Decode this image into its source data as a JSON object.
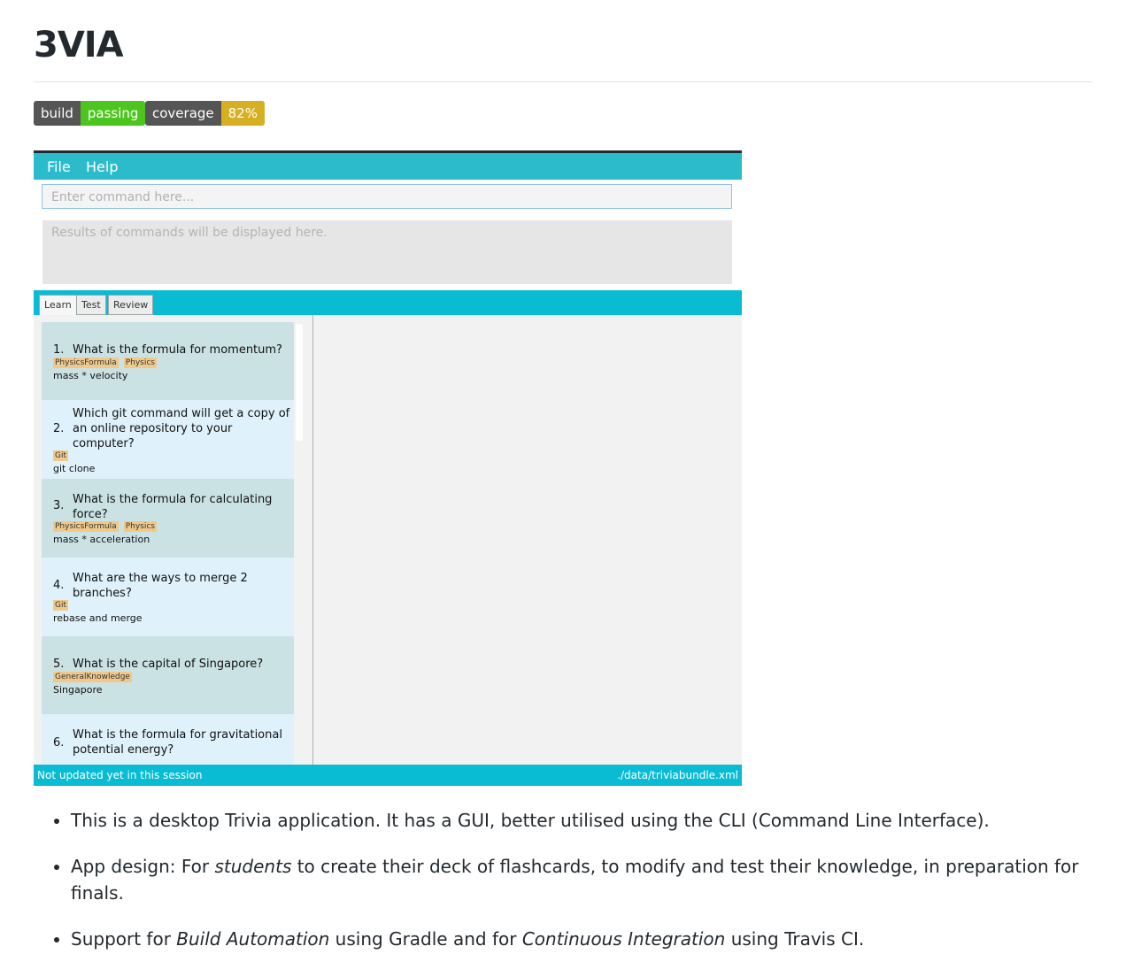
{
  "title": "3VIA",
  "badges": [
    {
      "left": "build",
      "right": "passing",
      "color": "#4cc61e"
    },
    {
      "left": "coverage",
      "right": "82%",
      "color": "#d6af22"
    }
  ],
  "app": {
    "menu": [
      "File",
      "Help"
    ],
    "command_placeholder": "Enter command here...",
    "result_placeholder": "Results of commands will be displayed here.",
    "tabs": [
      "Learn",
      "Test",
      "Review"
    ],
    "cards": [
      {
        "num": "1.",
        "question": "What is the formula for momentum?",
        "tags": [
          "PhysicsFormula",
          "Physics"
        ],
        "answer": "mass * velocity"
      },
      {
        "num": "2.",
        "question": "Which git command will get a copy of an online repository to your computer?",
        "tags": [
          "Git"
        ],
        "answer": "git clone"
      },
      {
        "num": "3.",
        "question": "What is the formula for calculating force?",
        "tags": [
          "PhysicsFormula",
          "Physics"
        ],
        "answer": "mass * acceleration"
      },
      {
        "num": "4.",
        "question": "What are the ways to merge 2 branches?",
        "tags": [
          "Git"
        ],
        "answer": "rebase and merge"
      },
      {
        "num": "5.",
        "question": "What is the capital of Singapore?",
        "tags": [
          "GeneralKnowledge"
        ],
        "answer": "Singapore"
      },
      {
        "num": "6.",
        "question": "What is the formula for gravitational potential energy?",
        "tags": [],
        "answer": ""
      }
    ],
    "status_left": "Not updated yet in this session",
    "status_right": "./data/triviabundle.xml"
  },
  "bullets": [
    {
      "parts": [
        {
          "t": "This is a desktop Trivia application. It has a GUI, better utilised using the CLI (Command Line Interface)."
        }
      ]
    },
    {
      "parts": [
        {
          "t": "App design: For "
        },
        {
          "t": "students",
          "em": true
        },
        {
          "t": " to create their deck of flashcards, to modify and test their knowledge, in preparation for finals."
        }
      ]
    },
    {
      "parts": [
        {
          "t": "Support for "
        },
        {
          "t": "Build Automation",
          "em": true
        },
        {
          "t": " using Gradle and for "
        },
        {
          "t": "Continuous Integration",
          "em": true
        },
        {
          "t": " using Travis CI."
        }
      ]
    }
  ]
}
